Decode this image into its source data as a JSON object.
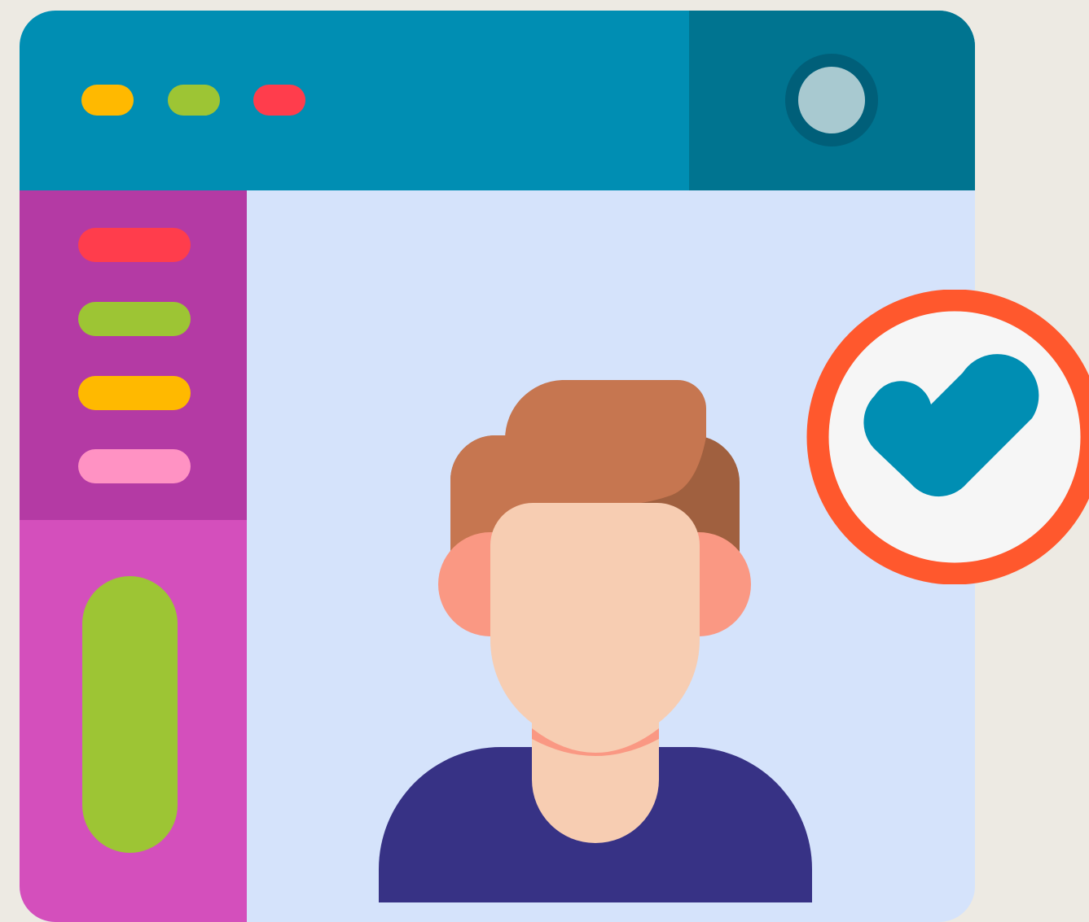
{
  "colors": {
    "background": "#EDEAE3",
    "titlebar": "#008EB3",
    "titlebar_dark": "#007490",
    "content": "#D5E3FB",
    "sidebar_top": "#B43AA4",
    "sidebar_bottom": "#D44FBC",
    "badge_ring": "#FF582D",
    "badge_fill": "#F6F6F6",
    "check": "#008EB3"
  },
  "window_dots": [
    "#FFB900",
    "#9DC534",
    "#FF3D4C"
  ],
  "sidebar": {
    "menu_items": [
      {
        "icon": "menu-line-red",
        "color": "#FF3D4C"
      },
      {
        "icon": "menu-line-green",
        "color": "#9DC534"
      },
      {
        "icon": "menu-line-yellow",
        "color": "#FFB900"
      },
      {
        "icon": "menu-line-pink",
        "color": "#FF92C3"
      }
    ],
    "scroll_indicator_color": "#9DC534"
  },
  "avatar": {
    "icon": "user-avatar-icon",
    "hair": "#C67650",
    "hair_shadow": "#A0603F",
    "skin": "#F7CDB2",
    "ears": "#FA9883",
    "shirt": "#373285"
  },
  "badge": {
    "icon": "checkmark-icon",
    "state": "verified"
  }
}
